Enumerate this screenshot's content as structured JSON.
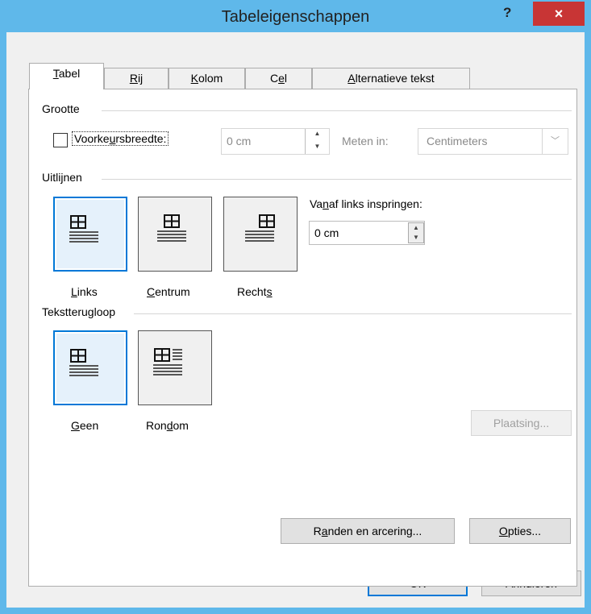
{
  "window": {
    "title": "Tabeleigenschappen",
    "help_label": "?",
    "close_label": "×"
  },
  "tabs": [
    {
      "label": "Tabel",
      "key": "T",
      "rest": "abel",
      "active": true
    },
    {
      "label": "Rij",
      "key": "R",
      "rest": "ij",
      "active": false
    },
    {
      "label": "Kolom",
      "key": "K",
      "rest": "olom",
      "active": false
    },
    {
      "label": "Cel",
      "key_pre": "C",
      "key": "e",
      "rest": "l",
      "active": false
    },
    {
      "label": "Alternatieve tekst",
      "key": "A",
      "rest": "lternatieve tekst",
      "active": false
    }
  ],
  "grootte": {
    "heading": "Grootte",
    "pref_width_pre": "Voorke",
    "pref_width_key": "u",
    "pref_width_rest": "rsbreedte:",
    "pref_width_checked": false,
    "width_value": "0 cm",
    "measure_label": "Meten in:",
    "measure_value": "Centimeters"
  },
  "uitlijnen": {
    "heading": "Uitlijnen",
    "options": [
      {
        "pre": "",
        "key": "L",
        "rest": "inks",
        "selected": true
      },
      {
        "pre": "",
        "key": "C",
        "rest": "entrum",
        "selected": false
      },
      {
        "pre": "Recht",
        "key": "s",
        "rest": "",
        "selected": false
      }
    ],
    "indent_pre": "Va",
    "indent_key": "n",
    "indent_rest": "af links inspringen:",
    "indent_value": "0 cm"
  },
  "tekstterugloop": {
    "heading": "Tekstterugloop",
    "options": [
      {
        "pre": "",
        "key": "G",
        "rest": "een",
        "selected": true
      },
      {
        "pre": "Ron",
        "key": "d",
        "rest": "om",
        "selected": false
      }
    ],
    "placement_label": "Plaatsing..."
  },
  "buttons": {
    "borders_pre": "R",
    "borders_key": "a",
    "borders_rest": "nden en arcering...",
    "options_key": "O",
    "options_rest": "pties...",
    "ok_label": "OK",
    "cancel_label": "Annuleren"
  },
  "colors": {
    "titlebar": "#5fb8ea",
    "close": "#c83535",
    "accent": "#0078d7"
  }
}
